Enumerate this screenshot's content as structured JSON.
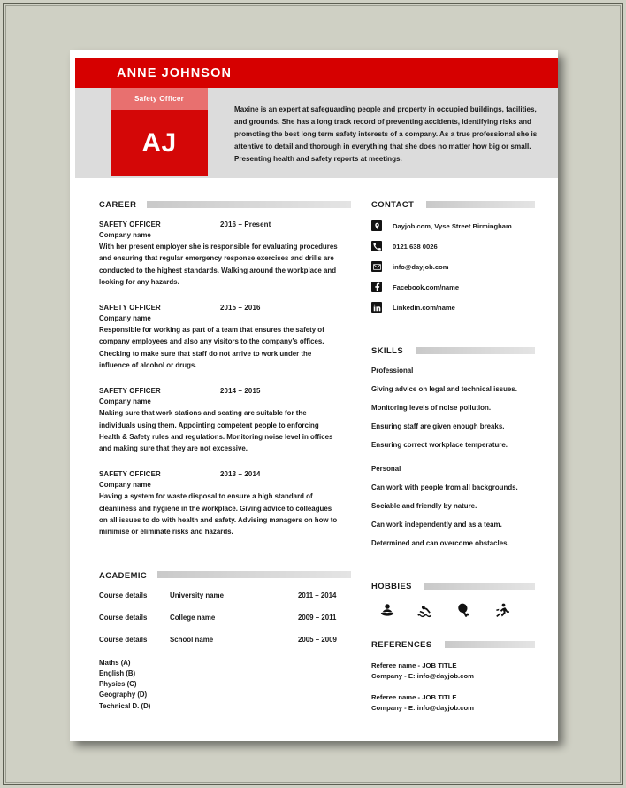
{
  "page": {
    "background_color": "#cfd0c4",
    "paper_color": "#ffffff",
    "accent_red": "#d60000",
    "accent_red_light": "#e8706f",
    "band_gray": "#dcdcdc"
  },
  "header": {
    "full_name": "ANNE JOHNSON",
    "job_title_chip": "Safety Officer",
    "monogram": "AJ",
    "summary": "Maxine is an expert at safeguarding people and property in occupied buildings, facilities, and grounds. She has a long track record of preventing accidents, identifying risks and promoting the best long term safety interests of a company. As a true professional she is attentive to detail and thorough in everything that she does no matter how big or small. Presenting health and safety reports at meetings."
  },
  "career": {
    "heading": "CAREER",
    "jobs": [
      {
        "title": "SAFETY OFFICER",
        "dates": "2016 – Present",
        "company": "Company name",
        "description": "With her present employer she is responsible for evaluating procedures and ensuring that regular emergency response exercises and drills are conducted to the highest standards. Walking around the workplace and looking for any hazards."
      },
      {
        "title": "SAFETY OFFICER",
        "dates": "2015 – 2016",
        "company": "Company name",
        "description": "Responsible for working as part of a team that ensures the safety of company employees and also any visitors to the company’s offices. Checking to make sure that staff do not arrive to work under the influence of alcohol or drugs."
      },
      {
        "title": "SAFETY OFFICER",
        "dates": "2014 – 2015",
        "company": "Company name",
        "description": "Making sure that work stations and seating are suitable for the individuals using them. Appointing competent people to enforcing Health & Safety rules and regulations. Monitoring noise level in offices and making sure that they are not excessive."
      },
      {
        "title": "SAFETY OFFICER",
        "dates": "2013 – 2014",
        "company": "Company name",
        "description": "Having a system for waste disposal to ensure a high standard of cleanliness and hygiene in the workplace. Giving advice to colleagues on all issues to do with health and safety. Advising managers on how to minimise or eliminate risks and hazards."
      }
    ]
  },
  "academic": {
    "heading": "ACADEMIC",
    "entries": [
      {
        "course": "Course details",
        "institution": "University name",
        "dates": "2011 – 2014"
      },
      {
        "course": "Course details",
        "institution": "College name",
        "dates": "2009 – 2011"
      },
      {
        "course": "Course details",
        "institution": "School name",
        "dates": "2005 – 2009"
      }
    ],
    "grades": [
      "Maths (A)",
      "English (B)",
      "Physics (C)",
      "Geography (D)",
      "Technical D. (D)"
    ]
  },
  "contact": {
    "heading": "CONTACT",
    "items": [
      {
        "icon": "location-pin-icon",
        "value": "Dayjob.com, Vyse Street Birmingham"
      },
      {
        "icon": "phone-icon",
        "value": "0121 638 0026"
      },
      {
        "icon": "envelope-icon",
        "value": "info@dayjob.com"
      },
      {
        "icon": "facebook-icon",
        "value": "Facebook.com/name"
      },
      {
        "icon": "linkedin-icon",
        "value": "Linkedin.com/name"
      }
    ]
  },
  "skills": {
    "heading": "SKILLS",
    "groups": [
      {
        "label": "Professional",
        "items": [
          "Giving advice on legal and technical issues.",
          "Monitoring levels of noise pollution.",
          "Ensuring staff are given enough breaks.",
          "Ensuring correct workplace temperature."
        ]
      },
      {
        "label": "Personal",
        "items": [
          "Can work with people from all backgrounds.",
          "Sociable and friendly by nature.",
          "Can work independently and as a team.",
          "Determined and can overcome obstacles."
        ]
      }
    ]
  },
  "hobbies": {
    "heading": "HOBBIES",
    "icons": [
      "reading-icon",
      "swimming-icon",
      "table-tennis-icon",
      "running-icon"
    ]
  },
  "references": {
    "heading": "REFERENCES",
    "entries": [
      {
        "line1": "Referee name - JOB TITLE",
        "line2": "Company - E: info@dayjob.com"
      },
      {
        "line1": "Referee name - JOB TITLE",
        "line2": "Company - E: info@dayjob.com"
      }
    ]
  }
}
